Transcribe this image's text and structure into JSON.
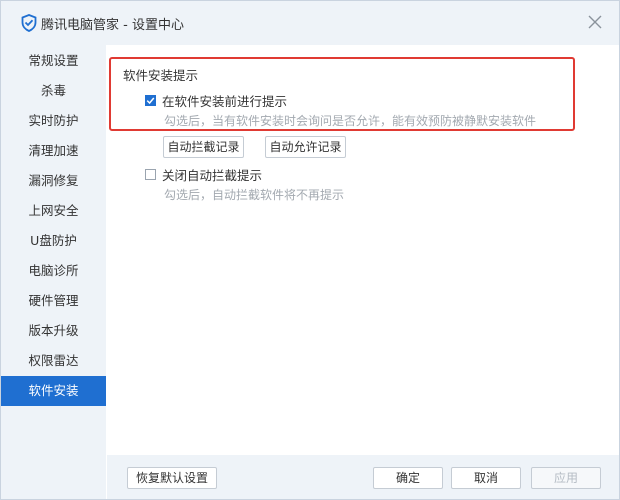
{
  "window": {
    "title": "腾讯电脑管家 - 设置中心",
    "logo_icon": "shield-icon",
    "close_icon": "close-icon"
  },
  "sidebar": {
    "items": [
      {
        "label": "常规设置",
        "active": false
      },
      {
        "label": "杀毒",
        "active": false
      },
      {
        "label": "实时防护",
        "active": false
      },
      {
        "label": "清理加速",
        "active": false
      },
      {
        "label": "漏洞修复",
        "active": false
      },
      {
        "label": "上网安全",
        "active": false
      },
      {
        "label": "U盘防护",
        "active": false
      },
      {
        "label": "电脑诊所",
        "active": false
      },
      {
        "label": "硬件管理",
        "active": false
      },
      {
        "label": "版本升级",
        "active": false
      },
      {
        "label": "权限雷达",
        "active": false
      },
      {
        "label": "软件安装",
        "active": true
      }
    ]
  },
  "content": {
    "section_title": "软件安装提示",
    "option1": {
      "label": "在软件安装前进行提示",
      "checked": true,
      "hint": "勾选后，当有软件安装时会询问是否允许，能有效预防被静默安装软件"
    },
    "buttons": {
      "block_log": "自动拦截记录",
      "allow_log": "自动允许记录"
    },
    "option2": {
      "label": "关闭自动拦截提示",
      "checked": false,
      "hint": "勾选后，自动拦截软件将不再提示"
    }
  },
  "footer": {
    "restore_default": "恢复默认设置",
    "ok": "确定",
    "cancel": "取消",
    "apply": "应用"
  },
  "colors": {
    "accent": "#1f6fd1",
    "highlight_border": "#e03a33",
    "hint_text": "#a3a9b0",
    "panel_bg": "#eef3f8"
  }
}
